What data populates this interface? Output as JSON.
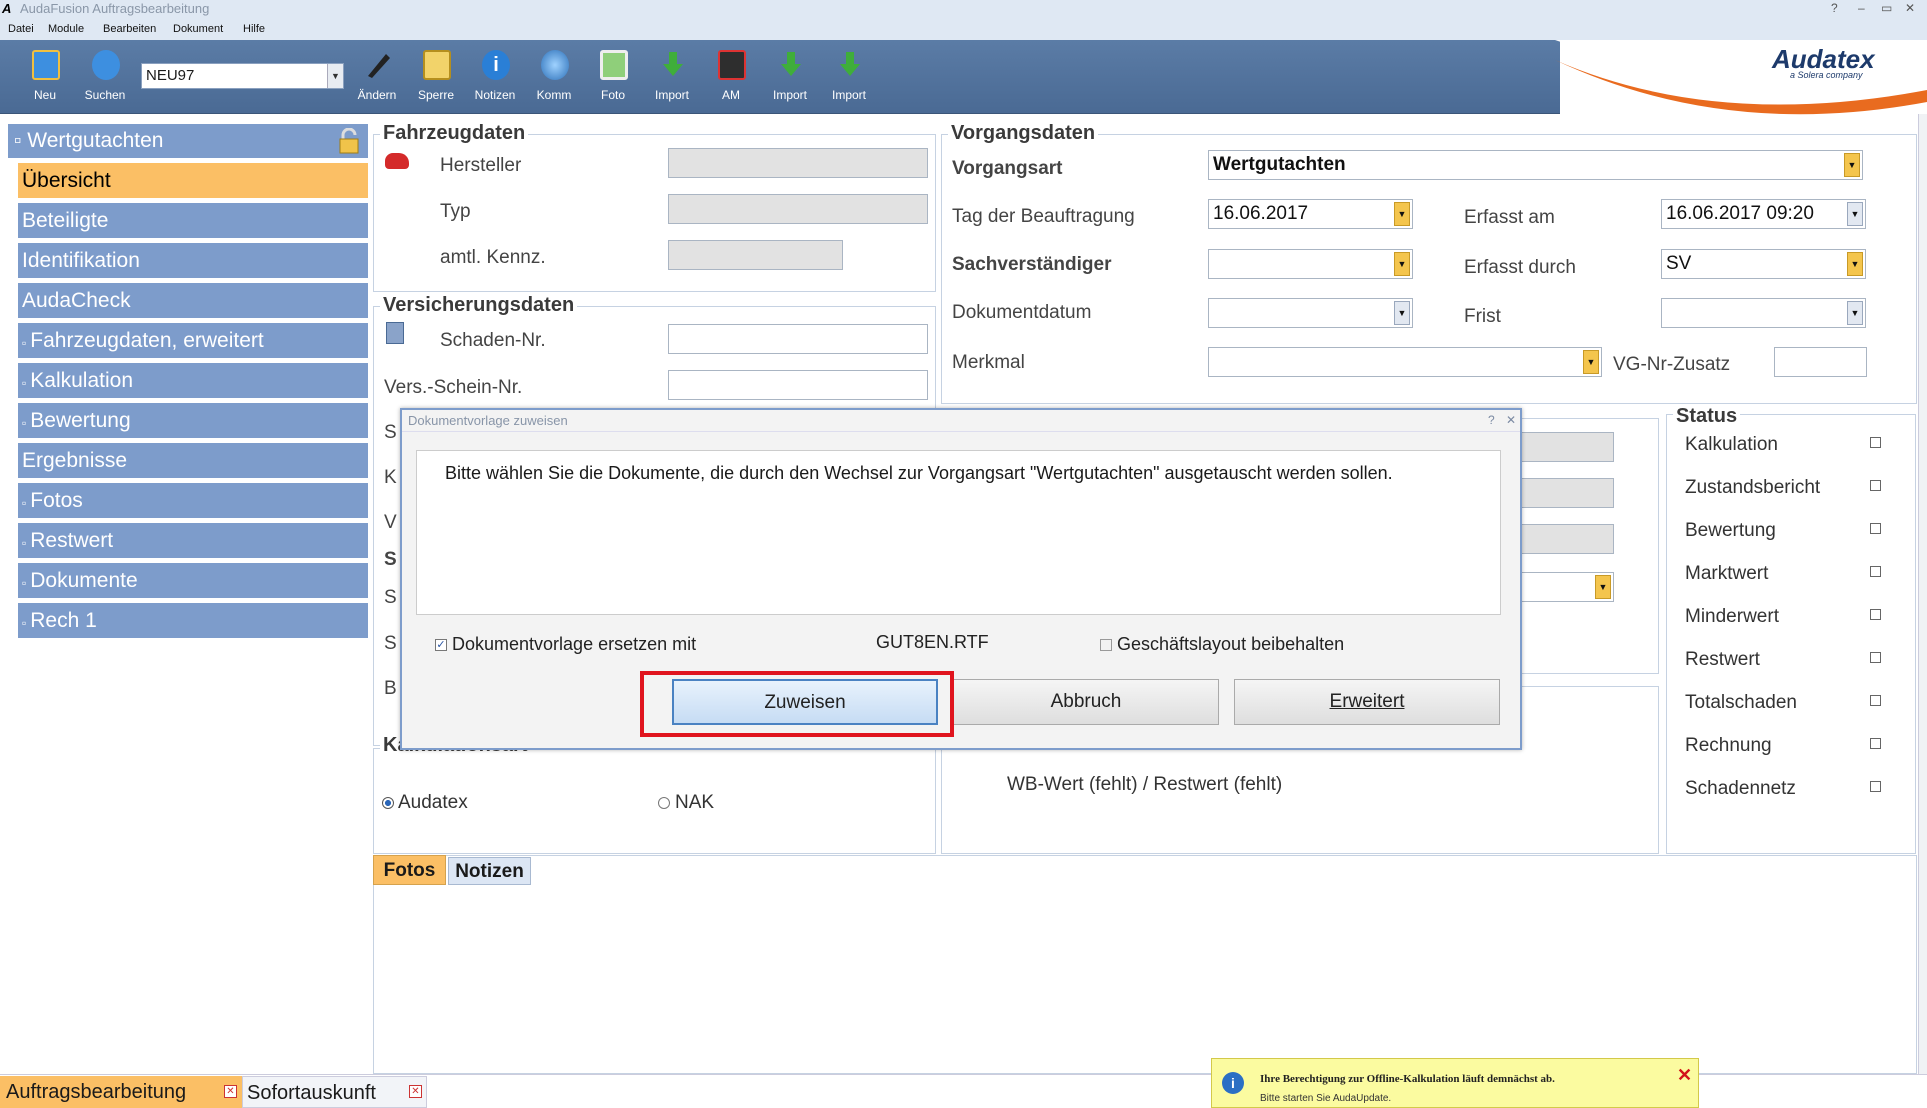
{
  "window": {
    "app_letter": "A",
    "title": "AudaFusion Auftragsbearbeitung",
    "controls": [
      "?",
      "–",
      "▭",
      "✕"
    ]
  },
  "menu": [
    "Datei",
    "Module",
    "Bearbeiten",
    "Dokument",
    "Hilfe"
  ],
  "toolbar": {
    "buttons_left": [
      {
        "label": "Neu",
        "icon": "new-doc-icon"
      },
      {
        "label": "Suchen",
        "icon": "search-icon"
      }
    ],
    "combo_value": "NEU97",
    "buttons_right": [
      {
        "label": "Ändern",
        "icon": "pen-icon"
      },
      {
        "label": "Sperre",
        "icon": "lock-icon"
      },
      {
        "label": "Notizen",
        "icon": "info-icon"
      },
      {
        "label": "Komm",
        "icon": "globe-icon"
      },
      {
        "label": "Foto",
        "icon": "photo-icon"
      },
      {
        "label": "Import",
        "icon": "import-icon"
      },
      {
        "label": "AM",
        "icon": "am-icon"
      },
      {
        "label": "Import",
        "icon": "import-icon"
      },
      {
        "label": "Import",
        "icon": "import-icon"
      }
    ]
  },
  "logo": {
    "name": "Audatex",
    "sub": "a Solera company"
  },
  "sidebar": {
    "header": "Wertgutachten",
    "header_prefix": "▫",
    "items": [
      {
        "label": "Übersicht",
        "active": true
      },
      {
        "label": "Beteiligte"
      },
      {
        "label": "Identifikation"
      },
      {
        "label": "AudaCheck"
      },
      {
        "label": "Fahrzeugdaten, erweitert",
        "prefix": "▫"
      },
      {
        "label": "Kalkulation",
        "prefix": "▫"
      },
      {
        "label": "Bewertung",
        "prefix": "▫"
      },
      {
        "label": "Ergebnisse"
      },
      {
        "label": "Fotos",
        "prefix": "▫"
      },
      {
        "label": "Restwert",
        "prefix": "▫"
      },
      {
        "label": "Dokumente",
        "prefix": "▫"
      },
      {
        "label": "Rech 1",
        "prefix": "▫"
      }
    ]
  },
  "fahrzeug": {
    "title": "Fahrzeugdaten",
    "hersteller": "Hersteller",
    "typ": "Typ",
    "kennz": "amtl. Kennz."
  },
  "versicherung": {
    "title": "Versicherungsdaten",
    "schaden_nr": "Schaden-Nr.",
    "vers_schein": "Vers.-Schein-Nr.",
    "partial": [
      "S",
      "K",
      "V",
      "S",
      "S",
      "S",
      "B"
    ]
  },
  "vorgang": {
    "title": "Vorgangsdaten",
    "vorgangsart_label": "Vorgangsart",
    "vorgangsart_value": "Wertgutachten",
    "tag_label": "Tag der Beauftragung",
    "tag_value": "16.06.2017",
    "erfasst_am_label": "Erfasst am",
    "erfasst_am_value": "16.06.2017 09:20",
    "sv_label": "Sachverständiger",
    "sv_value": "",
    "erfasst_durch_label": "Erfasst durch",
    "erfasst_durch_value": "SV",
    "dokdatum_label": "Dokumentdatum",
    "frist_label": "Frist",
    "merkmal_label": "Merkmal",
    "vgnr_label": "VG-Nr-Zusatz"
  },
  "status": {
    "title": "Status",
    "items": [
      "Kalkulation",
      "Zustandsbericht",
      "Bewertung",
      "Marktwert",
      "Minderwert",
      "Restwert",
      "Totalschaden",
      "Rechnung",
      "Schadennetz"
    ]
  },
  "kalk": {
    "title_partial": "Kalkulationsart",
    "opt1": "Audatex",
    "opt2": "NAK"
  },
  "wb": {
    "text": "WB-Wert (fehlt) / Restwert (fehlt)"
  },
  "tabs": [
    "Fotos",
    "Notizen"
  ],
  "dialog": {
    "title": "Dokumentvorlage zuweisen",
    "ctrl": [
      "?",
      "✕"
    ],
    "message": "Bitte wählen Sie die Dokumente, die durch den Wechsel zur Vorgangsart \"Wertgutachten\" ausgetauscht werden sollen.",
    "replace_label": "Dokumentvorlage ersetzen mit",
    "replace_file": "GUT8EN.RTF",
    "layout_label": "Geschäftslayout beibehalten",
    "btn_assign": "Zuweisen",
    "btn_cancel": "Abbruch",
    "btn_extended": "Erweitert"
  },
  "bottom_tabs": [
    "Auftragsbearbeitung",
    "Sofortauskunft"
  ],
  "notification": {
    "title": "Ihre Berechtigung zur Offline-Kalkulation läuft demnächst ab.",
    "body": "Bitte starten Sie AudaUpdate."
  },
  "colors": {
    "toolbar": "#5b7ca6",
    "sidebar": "#7d9ccb",
    "active": "#fbbf65",
    "highlight": "#e0141e"
  }
}
